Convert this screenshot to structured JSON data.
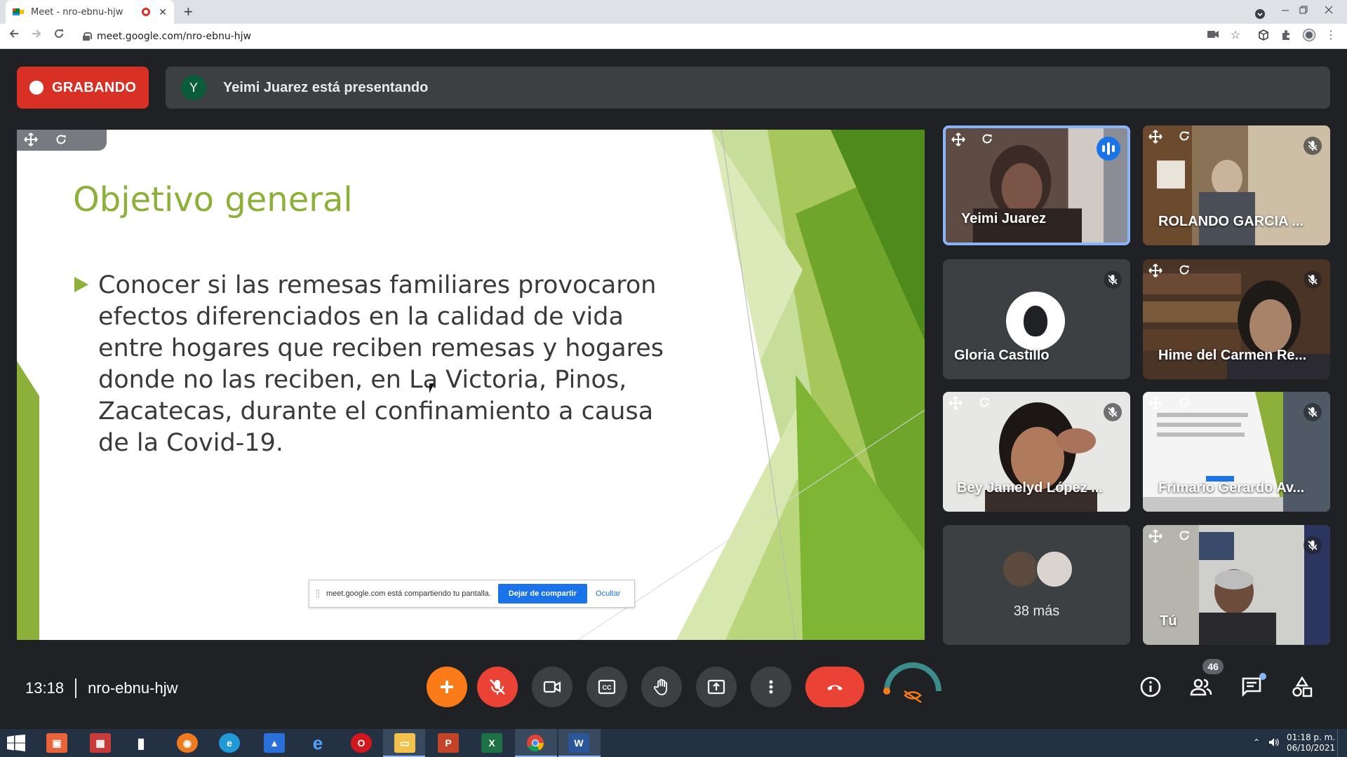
{
  "browser": {
    "tab_title": "Meet - nro-ebnu-hjw",
    "tab_close": "✕",
    "new_tab": "+",
    "url": "meet.google.com/nro-ebnu-hjw"
  },
  "header": {
    "recording_label": "GRABANDO",
    "presenter_initial": "Y",
    "presenting_text": "Yeimi Juarez está presentando"
  },
  "slide": {
    "title": "Objetivo general",
    "bullet": "Conocer si las remesas familiares provocaron efectos diferenciados en la calidad de vida entre hogares que reciben remesas y hogares donde no las reciben, en La Victoria, Pinos, Zacatecas, durante el confinamiento a causa de la Covid-19.",
    "share_message": "meet.google.com está compartiendo tu pantalla.",
    "stop_sharing": "Dejar de compartir",
    "hide": "Ocultar"
  },
  "participants": [
    {
      "name": "Yeimi Juarez",
      "speaking": true
    },
    {
      "name": "ROLANDO GARCIA ...",
      "muted": true
    },
    {
      "name": "Gloria Castillo",
      "muted": true
    },
    {
      "name": "Hime del Carmen Re...",
      "muted": true
    },
    {
      "name": "Bey Jamelyd López ...",
      "muted": true
    },
    {
      "name": "Frimario Gerardo Av...",
      "muted": true
    },
    {
      "more_label": "38 más"
    },
    {
      "name": "Tú",
      "muted": true
    }
  ],
  "bottom": {
    "time": "13:18",
    "meeting_code": "nro-ebnu-hjw",
    "people_count": "46"
  },
  "taskbar": {
    "clock_time": "01:18 p. m.",
    "clock_date": "06/10/2021"
  },
  "colors": {
    "recording_red": "#d93025",
    "slide_green": "#8cb03a",
    "meet_dark": "#202124",
    "end_call_red": "#ea4335",
    "activity_orange": "#fa7b17"
  },
  "icons": {
    "tab_favicon": "google-meet-icon",
    "recording_tab": "record-dot-icon",
    "controls": [
      "activities-plus-icon",
      "mic-off-icon",
      "camera-icon",
      "captions-icon",
      "raise-hand-icon",
      "present-screen-icon",
      "more-vert-icon",
      "end-call-icon",
      "visual-effects-icon"
    ],
    "right": [
      "info-icon",
      "people-icon",
      "chat-icon",
      "activities-icon"
    ]
  }
}
